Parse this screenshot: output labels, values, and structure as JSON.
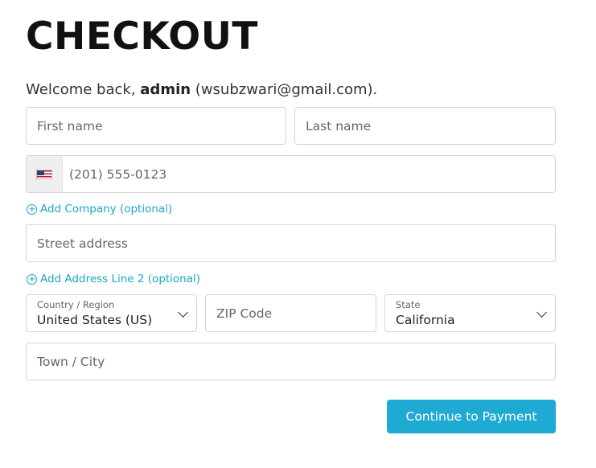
{
  "header": {
    "title": "CHECKOUT"
  },
  "welcome": {
    "prefix": "Welcome back, ",
    "username": "admin",
    "email": "(wsubzwari@gmail.com)."
  },
  "form": {
    "first_name": {
      "placeholder": "First name",
      "value": ""
    },
    "last_name": {
      "placeholder": "Last name",
      "value": ""
    },
    "phone": {
      "placeholder": "(201) 555-0123",
      "value": "",
      "country_flag": "us-flag-icon"
    },
    "add_company_label": "Add Company (optional)",
    "street": {
      "placeholder": "Street address",
      "value": ""
    },
    "add_address2_label": "Add Address Line 2 (optional)",
    "country": {
      "label": "Country / Region",
      "value": "United States (US)"
    },
    "zip": {
      "placeholder": "ZIP Code",
      "value": ""
    },
    "state": {
      "label": "State",
      "value": "California"
    },
    "city": {
      "placeholder": "Town / City",
      "value": ""
    }
  },
  "actions": {
    "continue_label": "Continue to Payment"
  },
  "colors": {
    "accent": "#1faad3",
    "link": "#1aa7c9",
    "border": "#d4d4d4"
  }
}
